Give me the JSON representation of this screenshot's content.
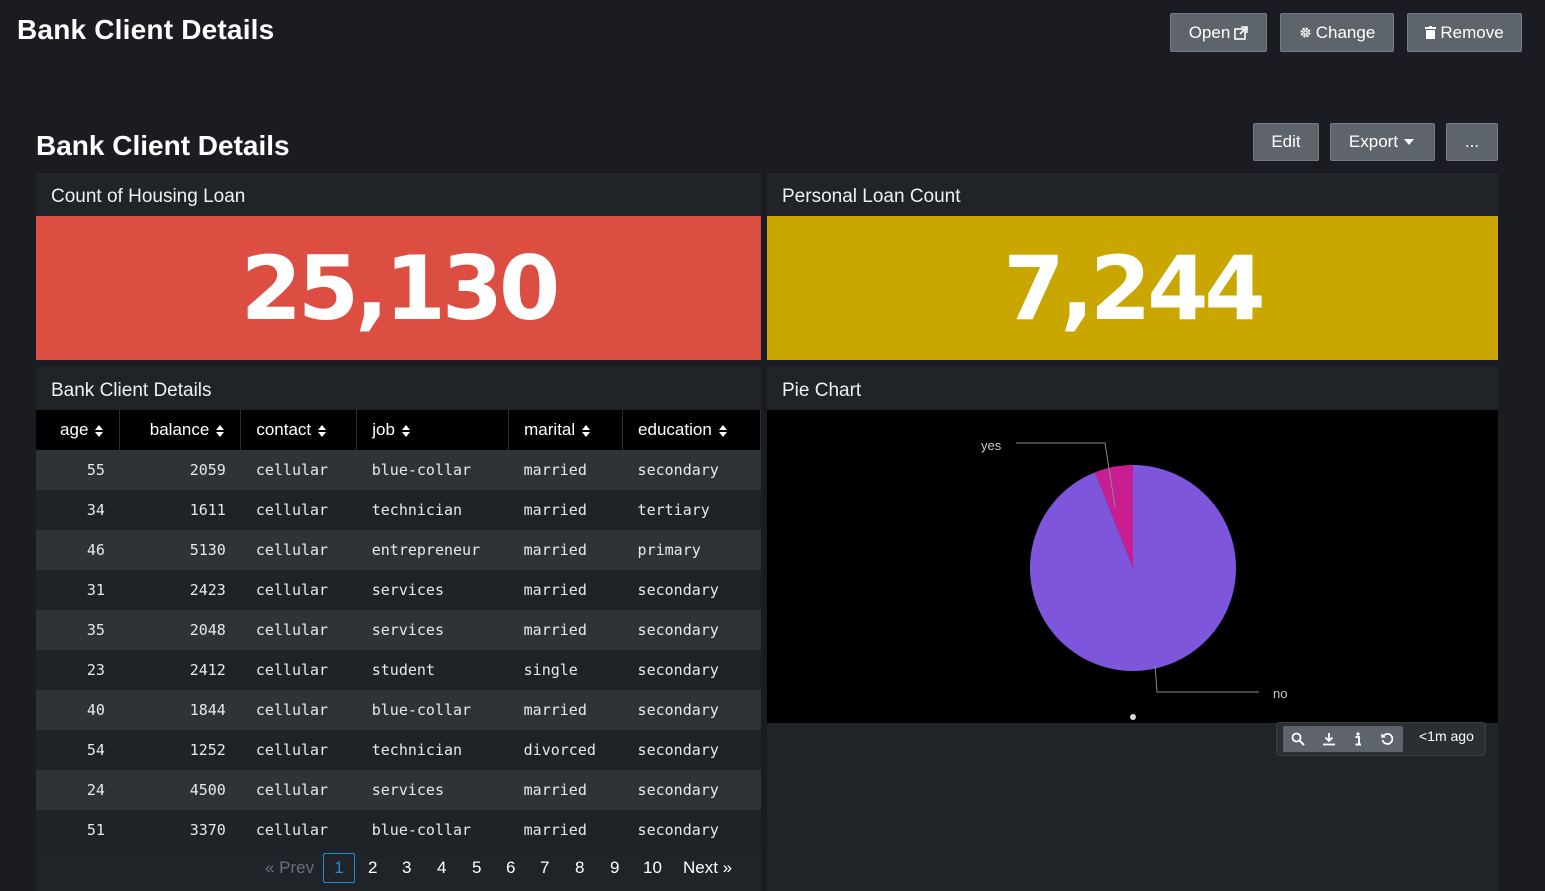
{
  "header": {
    "app_title": "Bank Client Details",
    "open_label": "Open",
    "change_label": "Change",
    "remove_label": "Remove"
  },
  "dashboard": {
    "title": "Bank Client Details",
    "edit_label": "Edit",
    "export_label": "Export",
    "more_label": "..."
  },
  "housing_panel": {
    "title": "Count of Housing Loan",
    "value": "25,130",
    "color": "#dc4e41"
  },
  "personal_panel": {
    "title": "Personal Loan Count",
    "value": "7,244",
    "color": "#c9a700"
  },
  "table_panel": {
    "title": "Bank Client Details",
    "columns": [
      "age",
      "balance",
      "contact",
      "job",
      "marital",
      "education"
    ],
    "rows": [
      [
        "55",
        "2059",
        "cellular",
        "blue-collar",
        "married",
        "secondary"
      ],
      [
        "34",
        "1611",
        "cellular",
        "technician",
        "married",
        "tertiary"
      ],
      [
        "46",
        "5130",
        "cellular",
        "entrepreneur",
        "married",
        "primary"
      ],
      [
        "31",
        "2423",
        "cellular",
        "services",
        "married",
        "secondary"
      ],
      [
        "35",
        "2048",
        "cellular",
        "services",
        "married",
        "secondary"
      ],
      [
        "23",
        "2412",
        "cellular",
        "student",
        "single",
        "secondary"
      ],
      [
        "40",
        "1844",
        "cellular",
        "blue-collar",
        "married",
        "secondary"
      ],
      [
        "54",
        "1252",
        "cellular",
        "technician",
        "divorced",
        "secondary"
      ],
      [
        "24",
        "4500",
        "cellular",
        "services",
        "married",
        "secondary"
      ],
      [
        "51",
        "3370",
        "cellular",
        "blue-collar",
        "married",
        "secondary"
      ]
    ],
    "pagination": {
      "prev": "« Prev",
      "pages": [
        "1",
        "2",
        "3",
        "4",
        "5",
        "6",
        "7",
        "8",
        "9",
        "10"
      ],
      "current": "1",
      "next": "Next »"
    }
  },
  "pie_panel": {
    "title": "Pie Chart",
    "last_updated": "<1m ago",
    "icons": [
      "search-icon",
      "download-icon",
      "info-icon",
      "refresh-icon"
    ]
  },
  "chart_data": {
    "type": "pie",
    "categories": [
      "no",
      "yes"
    ],
    "values": [
      94,
      6
    ],
    "colors": [
      "#7e56db",
      "#c81e92"
    ]
  }
}
